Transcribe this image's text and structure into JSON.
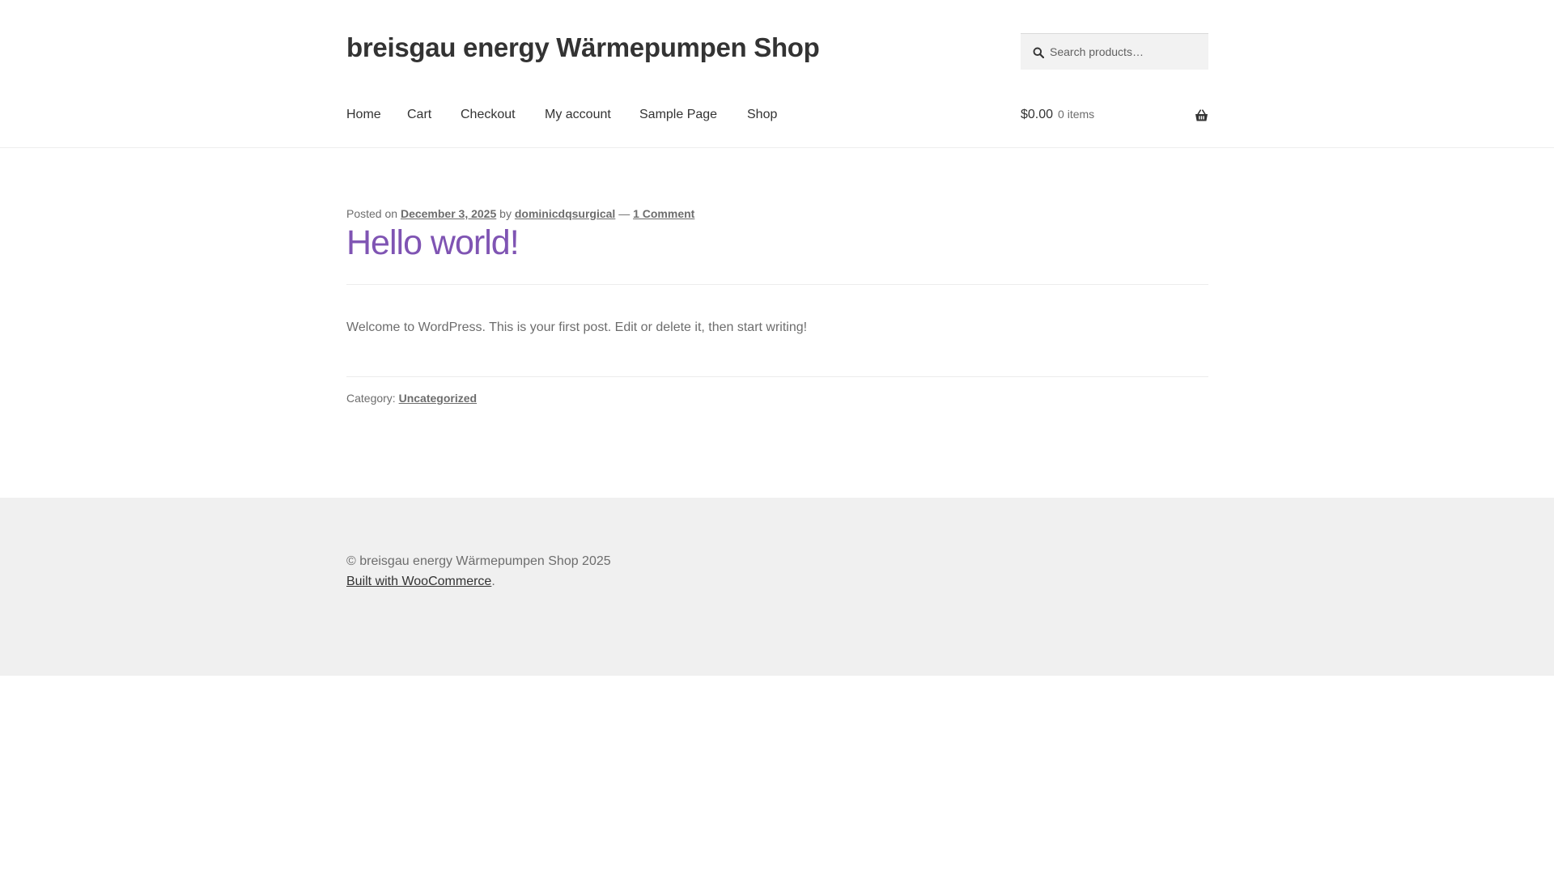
{
  "site": {
    "title": "breisgau energy Wärmepumpen Shop"
  },
  "search": {
    "placeholder": "Search products…"
  },
  "nav": {
    "home": "Home",
    "cart": "Cart",
    "checkout": "Checkout",
    "my_account": "My account",
    "sample_page": "Sample Page",
    "shop": "Shop"
  },
  "cart": {
    "amount": "$0.00",
    "count": "0 items",
    "icon": "basket-icon"
  },
  "post": {
    "posted_on_label": "Posted on",
    "date": "December 3, 2025",
    "by_label": "by",
    "author": "dominicdqsurgical",
    "dash": "—",
    "comments": "1 Comment",
    "title": "Hello world!",
    "body": "Welcome to WordPress. This is your first post. Edit or delete it, then start writing!",
    "category_label": "Category:",
    "category": "Uncategorized"
  },
  "footer": {
    "copyright": "© breisgau energy Wärmepumpen Shop 2025",
    "built_with": "Built with WooCommerce",
    "period": "."
  },
  "colors": {
    "accent": "#7f54b3",
    "heading": "#333333",
    "text": "#6d6d6d",
    "footer_bg": "#f0f0f0"
  }
}
